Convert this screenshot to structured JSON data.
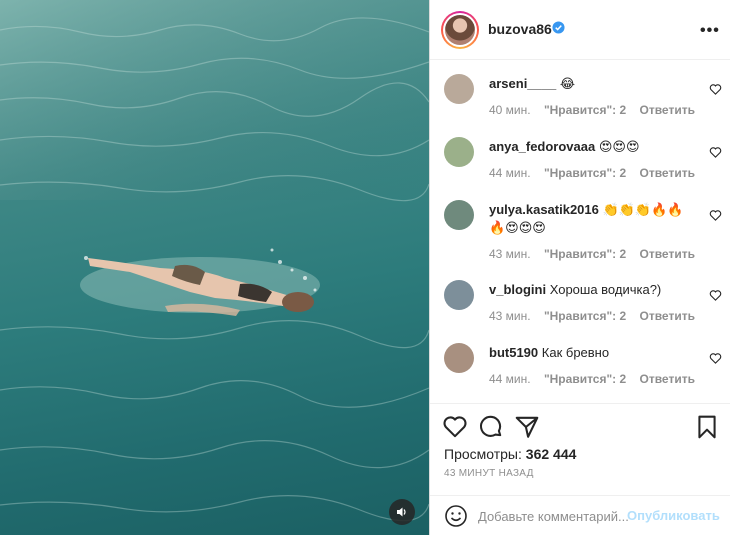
{
  "post": {
    "author": "buzova86",
    "verified": true,
    "more_label": "•••",
    "views_label": "Просмотры:",
    "views_count": "362 444",
    "timestamp": "43 МИНУТ НАЗАД"
  },
  "comments": [
    {
      "user": "arseni____",
      "text": "😂",
      "time": "40 мин.",
      "likes": "\"Нравится\": 2",
      "reply": "Ответить",
      "avatar_color": "#b9a99a"
    },
    {
      "user": "anya_fedorovaaa",
      "text": "😍😍😍",
      "time": "44 мин.",
      "likes": "\"Нравится\": 2",
      "reply": "Ответить",
      "avatar_color": "#9bb08a"
    },
    {
      "user": "yulya.kasatik2016",
      "text": "👏👏👏🔥🔥🔥😍😍😍",
      "time": "43 мин.",
      "likes": "\"Нравится\": 2",
      "reply": "Ответить",
      "avatar_color": "#6f8a7d"
    },
    {
      "user": "v_blogini",
      "text": "Хороша водичка?)",
      "time": "43 мин.",
      "likes": "\"Нравится\": 2",
      "reply": "Ответить",
      "avatar_color": "#7d8f9a"
    },
    {
      "user": "but5190",
      "text": "Как бревно",
      "time": "44 мин.",
      "likes": "\"Нравится\": 2",
      "reply": "Ответить",
      "avatar_color": "#a89080"
    }
  ],
  "composer": {
    "placeholder": "Добавьте комментарий...",
    "post_label": "Опубликовать"
  },
  "colors": {
    "verified_blue": "#3897f0",
    "post_disabled": "#b2dffc",
    "meta_gray": "#8e8e8e"
  },
  "icons": [
    "speaker-icon",
    "more-icon",
    "heart-icon",
    "comment-icon",
    "share-icon",
    "bookmark-icon",
    "emoji-icon",
    "verified-icon"
  ]
}
